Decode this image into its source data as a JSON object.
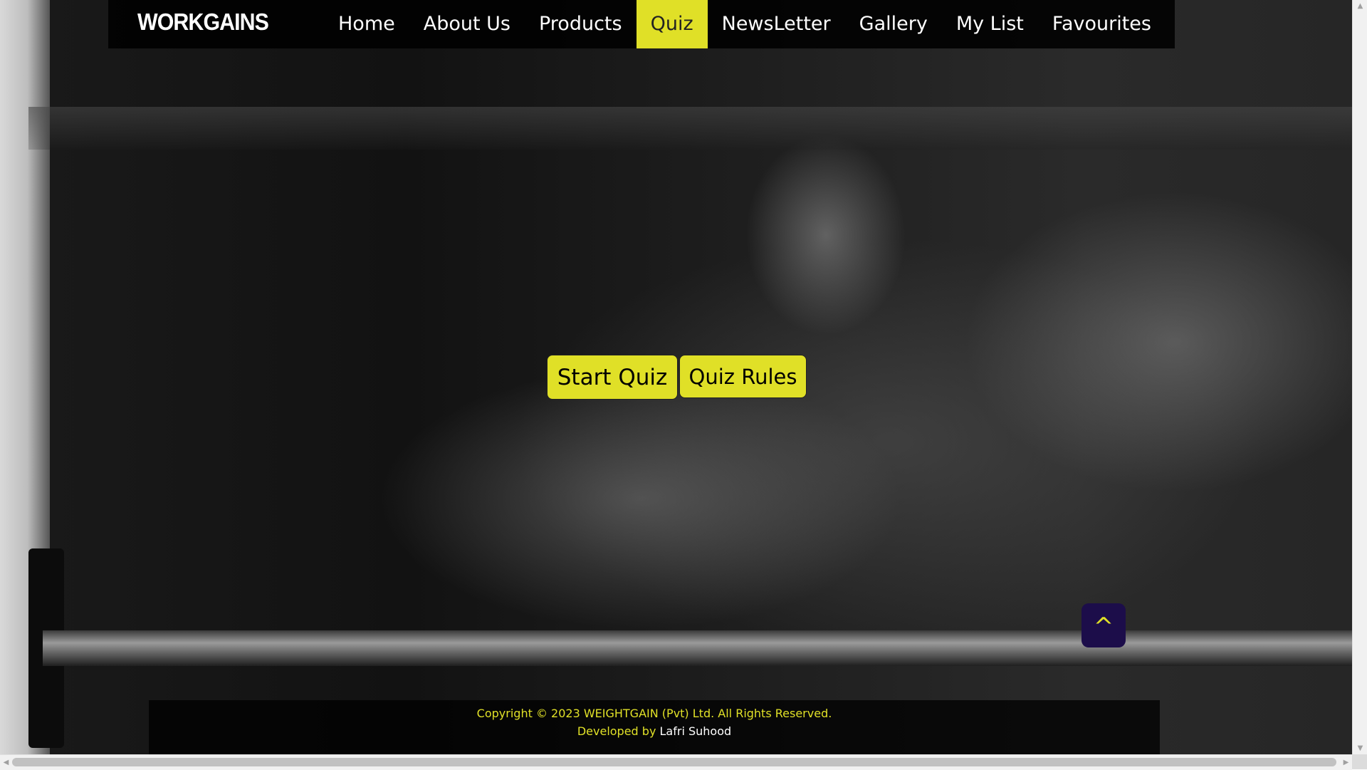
{
  "brand": {
    "logo_text": "WORKGAINS"
  },
  "nav": {
    "items": [
      {
        "label": "Home",
        "active": false
      },
      {
        "label": "About Us",
        "active": false
      },
      {
        "label": "Products",
        "active": false
      },
      {
        "label": "Quiz",
        "active": true
      },
      {
        "label": "NewsLetter",
        "active": false
      },
      {
        "label": "Gallery",
        "active": false
      },
      {
        "label": "My List",
        "active": false
      },
      {
        "label": "Favourites",
        "active": false
      }
    ]
  },
  "main": {
    "start_quiz_label": "Start Quiz",
    "quiz_rules_label": "Quiz Rules"
  },
  "back_to_top": {
    "label": "^"
  },
  "footer": {
    "copyright": "Copyright © 2023 WEIGHTGAIN (Pvt) Ltd. All Rights Reserved.",
    "developed_by_label": "Developed by",
    "developer_name": "Lafri Suhood"
  },
  "colors": {
    "accent": "#e0e027",
    "navbar_bg": "#000000",
    "back_to_top_bg": "#1c0d4a"
  },
  "icons": {
    "back_to_top": "caret-up-icon",
    "scroll_up": "triangle-up-icon",
    "scroll_down": "triangle-down-icon",
    "scroll_left": "triangle-left-icon",
    "scroll_right": "triangle-right-icon"
  }
}
